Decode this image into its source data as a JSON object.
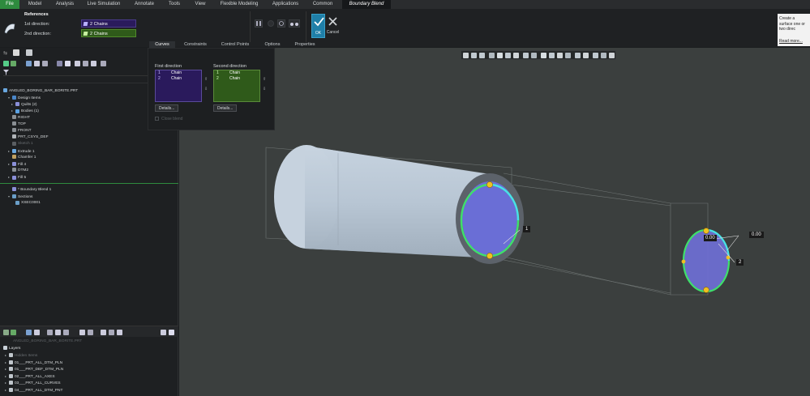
{
  "menubar": {
    "items": [
      "File",
      "Model",
      "Analysis",
      "Live Simulation",
      "Annotate",
      "Tools",
      "View",
      "Flexible Modeling",
      "Applications",
      "Common",
      "Boundary Blend"
    ]
  },
  "references": {
    "title": "References",
    "first_label": "1st direction:",
    "first_value": "2 Chains",
    "second_label": "2nd direction:",
    "second_value": "2 Chains"
  },
  "actions": {
    "ok": "OK",
    "cancel": "Cancel"
  },
  "tabs": [
    "Curves",
    "Constraints",
    "Control Points",
    "Options",
    "Properties"
  ],
  "panel": {
    "first_direction": {
      "title": "First direction",
      "rows": [
        {
          "index": "1",
          "label": "Chain"
        },
        {
          "index": "2",
          "label": "Chain"
        }
      ],
      "details": "Details..."
    },
    "second_direction": {
      "title": "Second direction",
      "rows": [
        {
          "index": "1",
          "label": "Chain"
        },
        {
          "index": "2",
          "label": "Chain"
        }
      ],
      "details": "Details..."
    },
    "close_blend": "Close blend"
  },
  "model_tree": {
    "root": "ANGLED_BORING_BAR_BORITE.PRT",
    "items": [
      {
        "label": "Design Items",
        "indent": 1,
        "toggle": "▾",
        "color": "#4a86c8"
      },
      {
        "label": "Quilts (2)",
        "indent": 2,
        "toggle": "▸",
        "color": "#8a8fd8"
      },
      {
        "label": "Bodies (1)",
        "indent": 2,
        "toggle": "▸",
        "color": "#5aa0e0"
      },
      {
        "label": "RIGHT",
        "indent": 1,
        "toggle": "",
        "color": "#8a8f94"
      },
      {
        "label": "TOP",
        "indent": 1,
        "toggle": "",
        "color": "#8a8f94"
      },
      {
        "label": "FRONT",
        "indent": 1,
        "toggle": "",
        "color": "#8a8f94"
      },
      {
        "label": "PRT_CSYS_DEF",
        "indent": 1,
        "toggle": "",
        "color": "#b0b4b8"
      },
      {
        "label": "Sketch 1",
        "indent": 1,
        "toggle": "",
        "color": "#5a5e62",
        "dim": true
      },
      {
        "label": "Extrude 1",
        "indent": 1,
        "toggle": "▸",
        "color": "#6aa8e0"
      },
      {
        "label": "Chamfer 1",
        "indent": 1,
        "toggle": "",
        "color": "#c0a060"
      },
      {
        "label": "Fill 4",
        "indent": 1,
        "toggle": "▸",
        "color": "#8a8fd8"
      },
      {
        "label": "DTM2",
        "indent": 1,
        "toggle": "",
        "color": "#8a8f94"
      },
      {
        "label": "Fill 5",
        "indent": 1,
        "toggle": "▸",
        "color": "#8a8fd8"
      }
    ],
    "insert_items": [
      {
        "label": "* Boundary Blend 1",
        "indent": 1,
        "toggle": "",
        "color": "#8a8fd8"
      },
      {
        "label": "Sections",
        "indent": 1,
        "toggle": "▾",
        "color": "#6a9ec8"
      },
      {
        "label": "XSEC0001",
        "indent": 2,
        "toggle": "",
        "color": "#6a9ec8"
      }
    ]
  },
  "layer_tree": {
    "file": "ANGLED_BORING_BAR_BORITE.PRT",
    "title": "Layers",
    "items": [
      "Hidden Items",
      "01___PRT_ALL_DTM_PLN",
      "01___PRT_DEF_DTM_PLN",
      "02___PRT_ALL_AXES",
      "03___PRT_ALL_CURVES",
      "04___PRT_ALL_DTM_PNT"
    ]
  },
  "canvas": {
    "labels": {
      "one": "1",
      "two": "2",
      "dim_a": "0.00",
      "dim_b": "0.00"
    }
  },
  "help": {
    "text": "Create a surface one or two direc",
    "link": "Read more..."
  },
  "colors": {
    "menu_active": "#2e8b3e",
    "first_collector": "#2a1a5c",
    "second_collector": "#2f5a1a",
    "ok_button": "#1f7fa8",
    "cylinder": "#b8c6d4",
    "chain_green": "#3ee06a",
    "chain_cyan": "#48e0e8",
    "section_face": "#7070d8"
  }
}
